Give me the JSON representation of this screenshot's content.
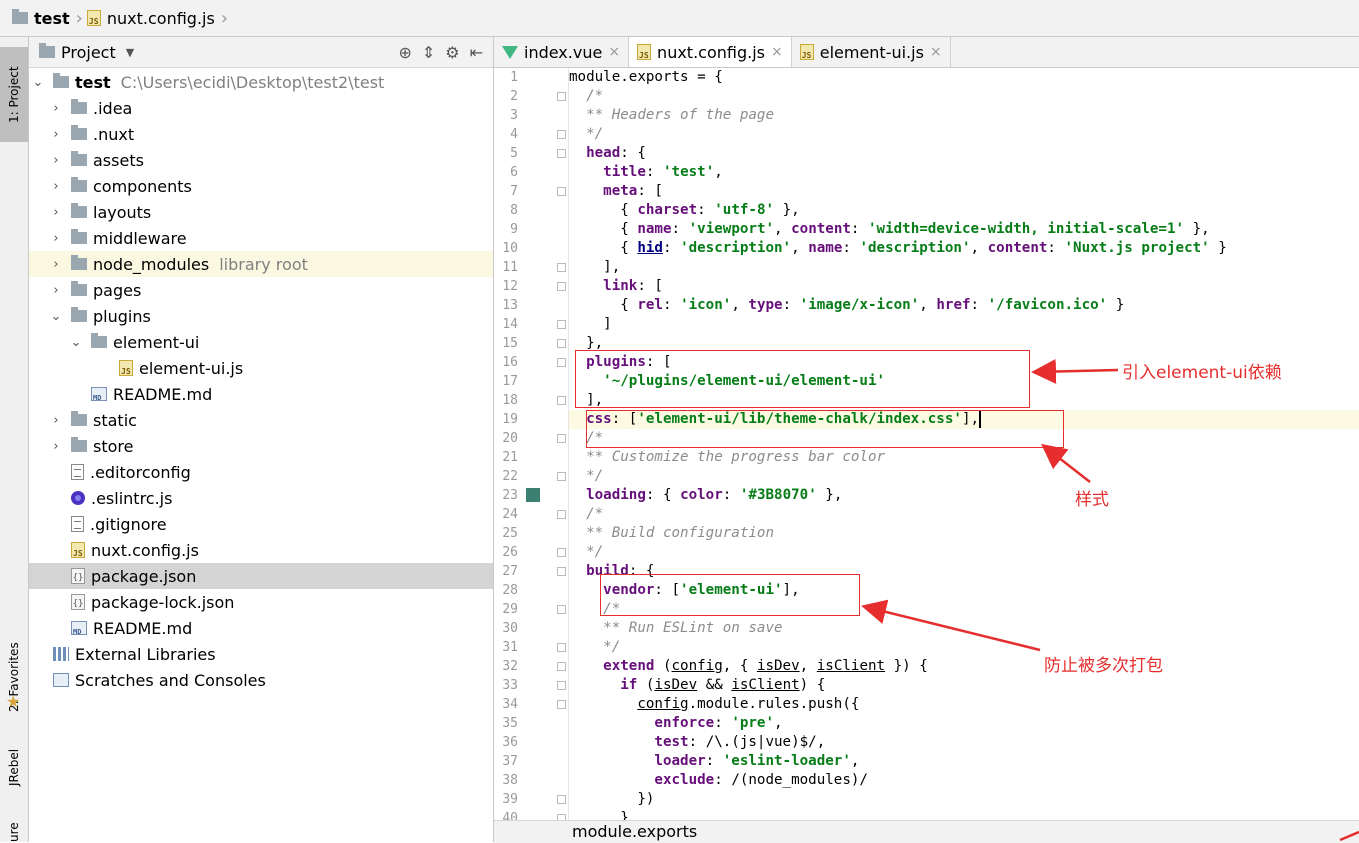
{
  "breadcrumb": {
    "project": "test",
    "file": "nuxt.config.js"
  },
  "toolstrip": {
    "project_tab": "1: Project",
    "favorites_tab": "2: Favorites",
    "jrebel_tab": "JRebel",
    "structure_tab": "ure"
  },
  "project_panel": {
    "title": "Project",
    "tree": [
      {
        "label": "test",
        "hint": "C:\\Users\\ecidi\\Desktop\\test2\\test",
        "icon": "folder-icon",
        "arrow": "v"
      },
      {
        "label": ".idea",
        "icon": "folder-icon",
        "arrow": ">"
      },
      {
        "label": ".nuxt",
        "icon": "folder-icon",
        "arrow": ">"
      },
      {
        "label": "assets",
        "icon": "folder-icon",
        "arrow": ">"
      },
      {
        "label": "components",
        "icon": "folder-icon",
        "arrow": ">"
      },
      {
        "label": "layouts",
        "icon": "folder-icon",
        "arrow": ">"
      },
      {
        "label": "middleware",
        "icon": "folder-icon",
        "arrow": ">"
      },
      {
        "label": "node_modules",
        "hint": "library root",
        "icon": "folder-icon",
        "arrow": ">"
      },
      {
        "label": "pages",
        "icon": "folder-icon",
        "arrow": ">"
      },
      {
        "label": "plugins",
        "icon": "folder-icon",
        "arrow": "v"
      },
      {
        "label": "element-ui",
        "icon": "folder-icon",
        "arrow": "v"
      },
      {
        "label": "element-ui.js",
        "icon": "js-file-icon"
      },
      {
        "label": "README.md",
        "icon": "md-file-icon"
      },
      {
        "label": "static",
        "icon": "folder-icon",
        "arrow": ">"
      },
      {
        "label": "store",
        "icon": "folder-icon",
        "arrow": ">"
      },
      {
        "label": ".editorconfig",
        "icon": "text-file-icon"
      },
      {
        "label": ".eslintrc.js",
        "icon": "eslint-icon"
      },
      {
        "label": ".gitignore",
        "icon": "text-file-icon"
      },
      {
        "label": "nuxt.config.js",
        "icon": "js-file-icon"
      },
      {
        "label": "package.json",
        "icon": "json-file-icon"
      },
      {
        "label": "package-lock.json",
        "icon": "json-file-icon"
      },
      {
        "label": "README.md",
        "icon": "md-file-icon"
      },
      {
        "label": "External Libraries",
        "icon": "library-icon"
      },
      {
        "label": "Scratches and Consoles",
        "icon": "scratch-icon"
      }
    ]
  },
  "editor": {
    "tabs": [
      {
        "label": "index.vue",
        "icon": "vue-icon"
      },
      {
        "label": "nuxt.config.js",
        "icon": "js-file-icon",
        "active": true
      },
      {
        "label": "element-ui.js",
        "icon": "js-file-icon"
      }
    ],
    "line_numbers": [
      "1",
      "2",
      "3",
      "4",
      "5",
      "6",
      "7",
      "8",
      "9",
      "10",
      "11",
      "12",
      "13",
      "14",
      "15",
      "16",
      "17",
      "18",
      "19",
      "20",
      "21",
      "22",
      "23",
      "24",
      "25",
      "26",
      "27",
      "28",
      "29",
      "30",
      "31",
      "32",
      "33",
      "34",
      "35",
      "36",
      "37",
      "38",
      "39",
      "40"
    ],
    "code": {
      "l1": "module.exports = {",
      "l2": "  /*",
      "l3": "  ** Headers of the page",
      "l4": "  */",
      "l5a": "head",
      "l5b": ": {",
      "l6a": "title",
      "l6b": "'test'",
      "l7a": "meta",
      "l7b": ": [",
      "l8a": "charset",
      "l8b": "'utf-8'",
      "l9a": "name",
      "l9b": "'viewport'",
      "l9c": "content",
      "l9d": "'width=device-width, initial-scale=1'",
      "l10a": "hid",
      "l10b": "'description'",
      "l10c": "name",
      "l10d": "'description'",
      "l10e": "content",
      "l10f": "'Nuxt.js project'",
      "l11": "    ],",
      "l12a": "link",
      "l12b": ": [",
      "l13a": "rel",
      "l13b": "'icon'",
      "l13c": "type",
      "l13d": "'image/x-icon'",
      "l13e": "href",
      "l13f": "'/favicon.ico'",
      "l14": "    ]",
      "l15": "  },",
      "l16a": "plugins",
      "l16b": ": [",
      "l17": "'~/plugins/element-ui/element-ui'",
      "l18": "  ],",
      "l19a": "css",
      "l19b": "'element-ui/lib/theme-chalk/index.css'",
      "l20": "  /*",
      "l21": "  ** Customize the progress bar color",
      "l22": "  */",
      "l23a": "loading",
      "l23b": "color",
      "l23c": "'#3B8070'",
      "l24": "  /*",
      "l25": "  ** Build configuration",
      "l26": "  */",
      "l27a": "build",
      "l27b": ": {",
      "l28a": "vendor",
      "l28b": "'element-ui'",
      "l29": "    /*",
      "l30": "    ** Run ESLint on save",
      "l31": "    */",
      "l32a": "extend",
      "l32b": "config",
      "l32c": "isDev",
      "l32d": "isClient",
      "l33a": "if",
      "l33b": "isDev",
      "l33c": "isClient",
      "l34a": "config",
      "l34b": ".module.rules.push({",
      "l35a": "enforce",
      "l35b": "'pre'",
      "l36a": "test",
      "l36b": "/\\.(js|vue)$/",
      "l37a": "loader",
      "l37b": "'eslint-loader'",
      "l38a": "exclude",
      "l38b": "/(node_modules)/",
      "l39": "        })",
      "l40": "      }"
    },
    "color_swatch": "#3B8070",
    "status_breadcrumb": "module.exports"
  },
  "annotations": {
    "plugins_note": "引入element-ui依赖",
    "css_note": "样式",
    "vendor_note": "防止被多次打包",
    "color": "#e62e2e"
  }
}
